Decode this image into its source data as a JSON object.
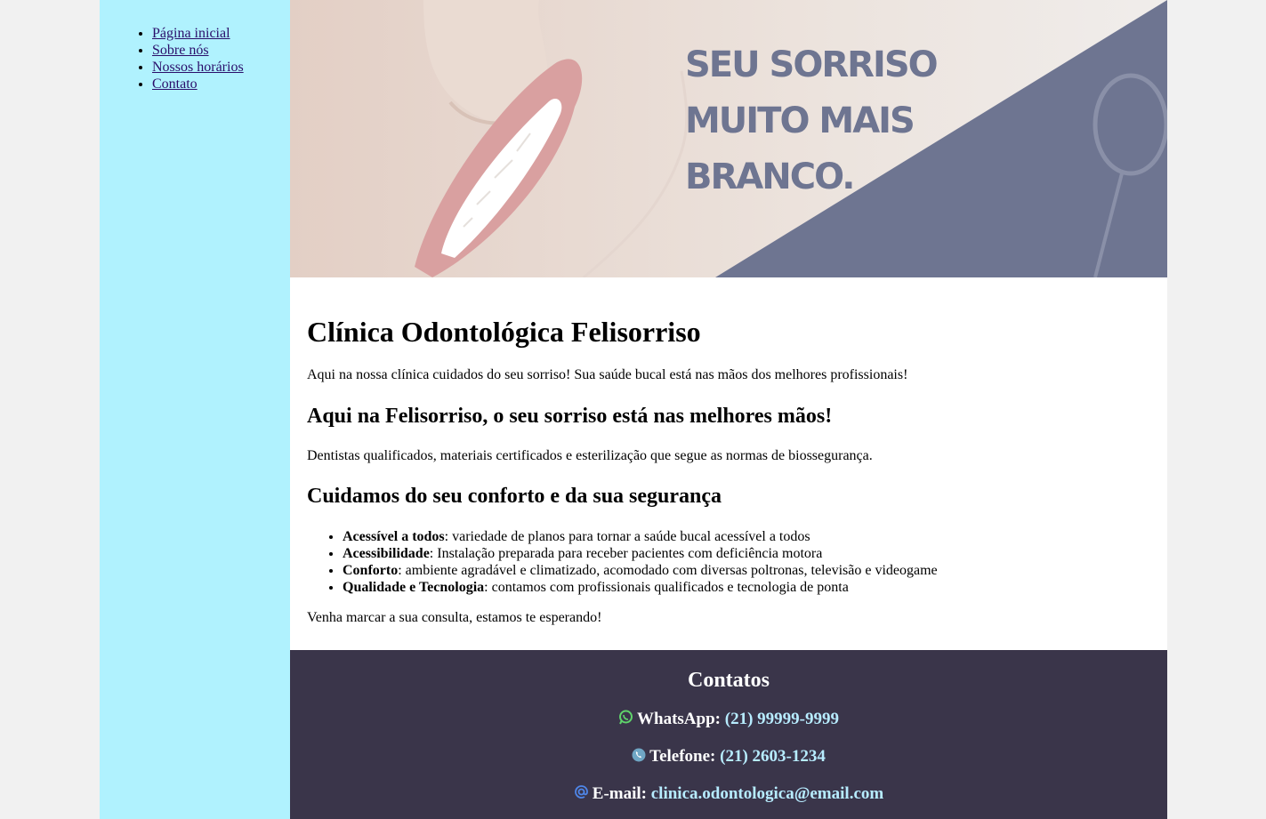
{
  "nav": {
    "items": [
      {
        "label": "Página inicial"
      },
      {
        "label": "Sobre nós"
      },
      {
        "label": "Nossos horários"
      },
      {
        "label": "Contato"
      }
    ]
  },
  "banner": {
    "line1": "SEU SORRISO",
    "line2": "MUITO MAIS",
    "line3": "BRANCO."
  },
  "main": {
    "title": "Clínica Odontológica Felisorriso",
    "intro": "Aqui na nossa clínica cuidados do seu sorriso! Sua saúde bucal está nas mãos dos melhores profissionais!",
    "heading2": "Aqui na Felisorriso, o seu sorriso está nas melhores mãos!",
    "para2": "Dentistas qualificados, materiais certificados e esterilização que segue as normas de biossegurança.",
    "heading3": "Cuidamos do seu conforto e da sua segurança",
    "features": [
      {
        "title": "Acessível a todos",
        "text": ": variedade de planos para tornar a saúde bucal acessível a todos"
      },
      {
        "title": "Acessibilidade",
        "text": ": Instalação preparada para receber pacientes com deficiência motora"
      },
      {
        "title": "Conforto",
        "text": ": ambiente agradável e climatizado, acomodado com diversas poltronas, televisão e videogame"
      },
      {
        "title": "Qualidade e Tecnologia",
        "text": ": contamos com profissionais qualificados e tecnologia de ponta"
      }
    ],
    "closing": "Venha marcar a sua consulta, estamos te esperando!"
  },
  "footer": {
    "title": "Contatos",
    "whatsapp_label": "WhatsApp:",
    "whatsapp_value": "(21) 99999-9999",
    "phone_label": "Telefone:",
    "phone_value": "(21) 2603-1234",
    "email_label": "E-mail:",
    "email_value": "clinica.odontologica@email.com"
  },
  "colors": {
    "sidebar_bg": "#b0f2fe",
    "banner_accent": "#6e7591",
    "footer_bg": "#3a354a",
    "link_light": "#b7ecff"
  },
  "icons": [
    "whatsapp-icon",
    "phone-icon",
    "email-icon"
  ]
}
